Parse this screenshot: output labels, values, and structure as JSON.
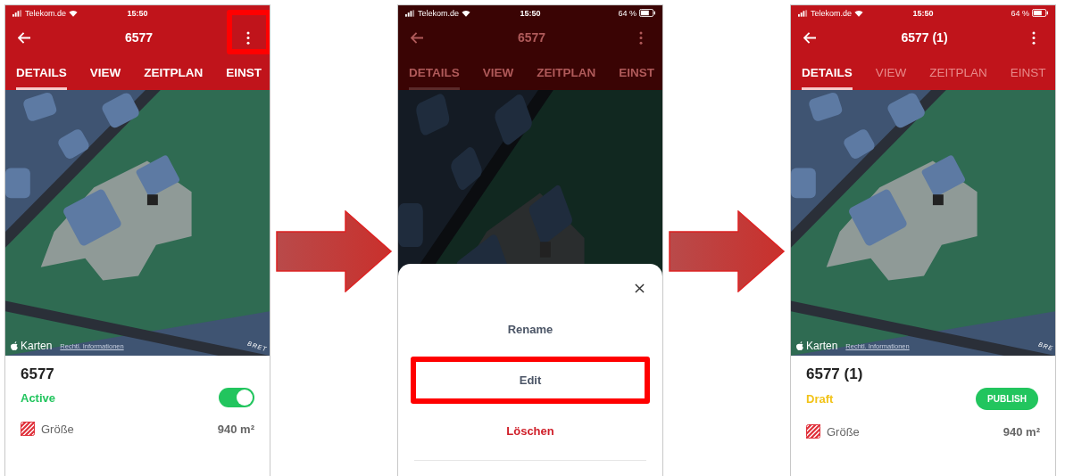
{
  "screens": [
    {
      "status_bar": {
        "carrier": "Telekom.de",
        "time": "15:50"
      },
      "app_bar": {
        "title": "6577",
        "menu_highlighted": true
      },
      "dimmed": false,
      "tabs": [
        {
          "label": "DETAILS",
          "selected": true,
          "disabled": false
        },
        {
          "label": "VIEW",
          "selected": false,
          "disabled": false
        },
        {
          "label": "ZEITPLAN",
          "selected": false,
          "disabled": false
        },
        {
          "label": "EINST",
          "selected": false,
          "disabled": false
        }
      ],
      "map": {
        "brand": "Karten",
        "legal": "Rechtl. Informationen",
        "street": "BRET"
      },
      "details": {
        "name": "6577",
        "status": {
          "kind": "toggle",
          "label": "Active",
          "on": true
        },
        "area": {
          "label": "Größe",
          "value": "940 m²"
        }
      }
    },
    {
      "status_bar": {
        "carrier": "Telekom.de",
        "time": "15:50",
        "battery": "64 %"
      },
      "app_bar": {
        "title": "6577",
        "menu_highlighted": false
      },
      "dimmed": true,
      "tabs": [
        {
          "label": "DETAILS",
          "selected": true,
          "disabled": false
        },
        {
          "label": "VIEW",
          "selected": false,
          "disabled": false
        },
        {
          "label": "ZEITPLAN",
          "selected": false,
          "disabled": false
        },
        {
          "label": "EINST",
          "selected": false,
          "disabled": false
        }
      ],
      "sheet": {
        "items": [
          {
            "label": "Rename",
            "kind": "neutral",
            "highlighted": false
          },
          {
            "label": "Edit",
            "kind": "neutral",
            "highlighted": true
          },
          {
            "label": "Löschen",
            "kind": "danger",
            "highlighted": false
          }
        ]
      }
    },
    {
      "status_bar": {
        "carrier": "Telekom.de",
        "time": "15:50",
        "battery": "64 %"
      },
      "app_bar": {
        "title": "6577 (1)",
        "menu_highlighted": false
      },
      "dimmed": false,
      "tabs": [
        {
          "label": "DETAILS",
          "selected": true,
          "disabled": false
        },
        {
          "label": "VIEW",
          "selected": false,
          "disabled": true
        },
        {
          "label": "ZEITPLAN",
          "selected": false,
          "disabled": true
        },
        {
          "label": "EINST",
          "selected": false,
          "disabled": true
        }
      ],
      "map": {
        "brand": "Karten",
        "legal": "Rechtl. Informationen",
        "street": "BRE"
      },
      "details": {
        "name": "6577 (1)",
        "status": {
          "kind": "publish",
          "label": "Draft",
          "action": "PUBLISH"
        },
        "area": {
          "label": "Größe",
          "value": "940 m²"
        }
      }
    }
  ]
}
